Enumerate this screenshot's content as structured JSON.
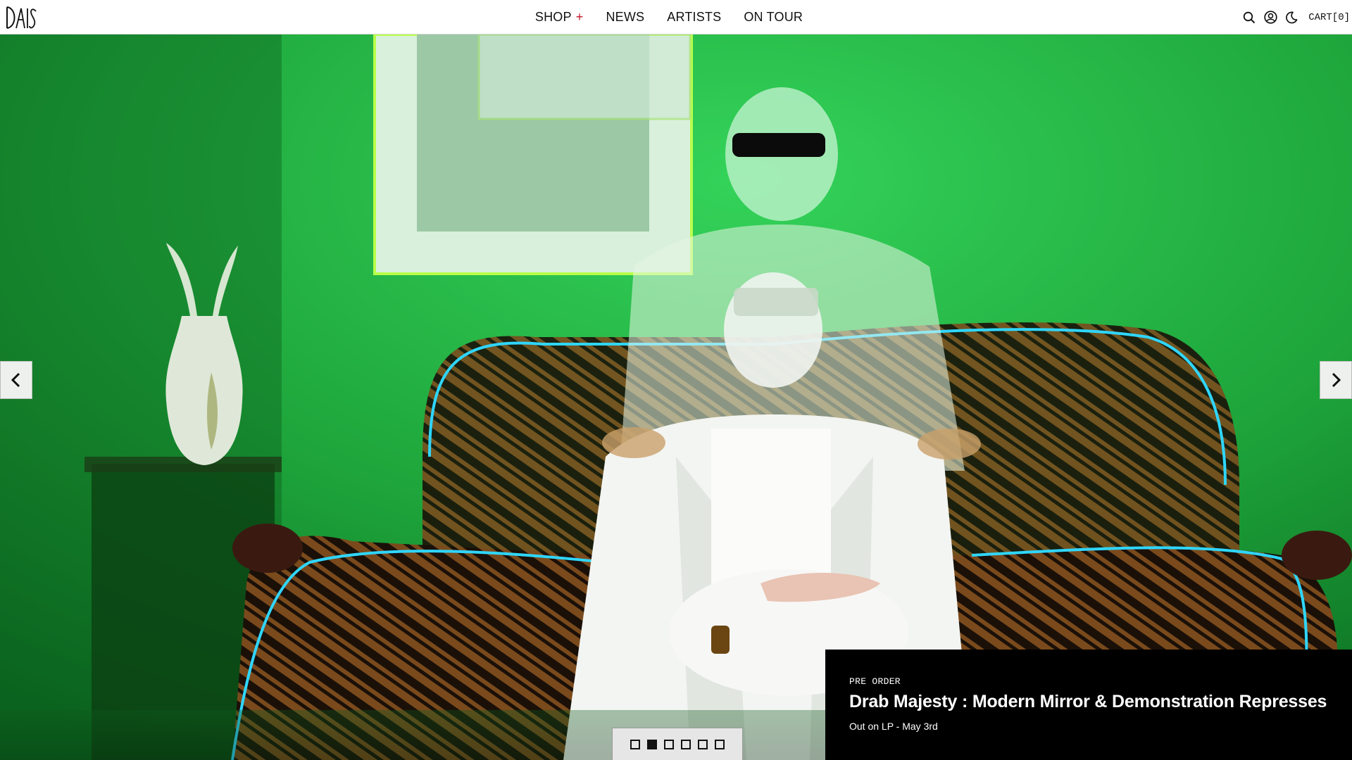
{
  "header": {
    "logo_text": "DAIS",
    "nav": [
      {
        "label": "SHOP",
        "suffix": "+"
      },
      {
        "label": "NEWS"
      },
      {
        "label": "ARTISTS"
      },
      {
        "label": "ON TOUR"
      }
    ],
    "icons": [
      "search-icon",
      "account-icon",
      "dark-mode-icon"
    ],
    "cart_label": "CART[0]"
  },
  "hero": {
    "kicker": "PRE ORDER",
    "title": "Drab Majesty : Modern Mirror & Demonstration Represses",
    "subtitle": "Out on LP - May 3rd",
    "slides_total": 6,
    "active_slide": 2,
    "prev_icon": "chevron-left-icon",
    "next_icon": "chevron-right-icon"
  },
  "colors": {
    "wall_green": "#1fa73c",
    "accent_red": "#c0182a",
    "caption_bg": "#000000"
  }
}
